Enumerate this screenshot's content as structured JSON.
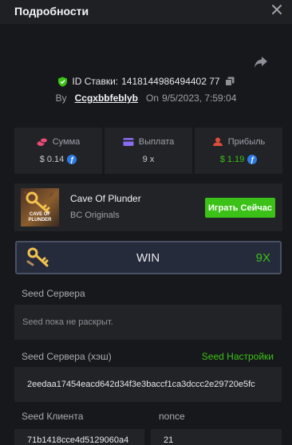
{
  "header": {
    "title": "Подробности"
  },
  "bet": {
    "id_label": "ID Ставки:",
    "id_value": "1418144986494402 77",
    "by_label": "By",
    "username": "Ccgxbbfeblyb",
    "on_label": "On",
    "date": "9/5/2023, 7:59:04"
  },
  "stats": [
    {
      "label": "Сумма",
      "value": "$ 0.14",
      "color": "#e94a76",
      "icon": "coins-icon"
    },
    {
      "label": "Выплата",
      "value": "9 x",
      "color": "#8a6cf0",
      "icon": "card-icon"
    },
    {
      "label": "Прибыль",
      "value": "$ 1.19",
      "color": "#e04c3a",
      "icon": "profit-icon"
    }
  ],
  "coin_symbol": "ƒ",
  "game": {
    "name": "Cave Of Plunder",
    "provider": "BC Originals",
    "thumb_label": "CAVE OF PLUNDER",
    "play_label": "Играть Сейчас"
  },
  "result": {
    "label": "WIN",
    "multiplier": "9X"
  },
  "fields": {
    "server_seed_label": "Seed Сервера",
    "server_seed_value": "Seed пока не раскрыт.",
    "server_hash_label": "Seed Сервера (хэш)",
    "seed_settings_link": "Seed Настройки",
    "server_hash_value": "2eedaa17454eacd642d34f3e3baccf1ca3dccc2e29720e5fc",
    "client_seed_label": "Seed Клиента",
    "client_seed_value": "71b1418cce4d5129060a4",
    "nonce_label": "nonce",
    "nonce_value": "21"
  },
  "colors": {
    "accent_green": "#3bc117",
    "panel": "#222327",
    "background": "#17181b"
  }
}
